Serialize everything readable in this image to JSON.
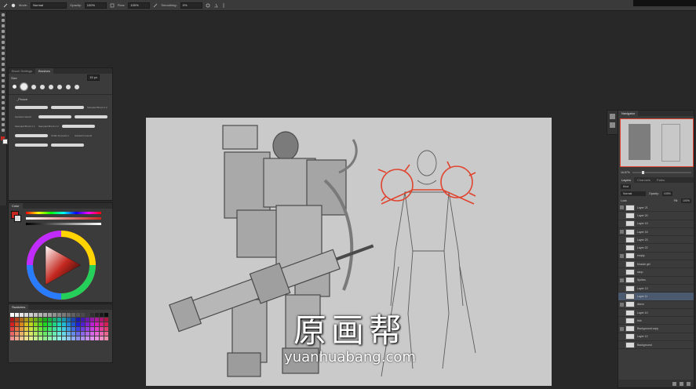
{
  "options_bar": {
    "mode_label": "Mode:",
    "mode_value": "Normal",
    "opacity_label": "Opacity:",
    "opacity_value": "100%",
    "flow_label": "Flow:",
    "flow_value": "100%",
    "smoothing_label": "Smoothing:",
    "smoothing_value": "0%"
  },
  "brush_panel": {
    "tabs": [
      "Brush Settings",
      "Brushes"
    ],
    "size_label": "Size",
    "size_value": "15 px",
    "group_label": "_Procre",
    "brushes": [
      "Sampled Brush 4 2",
      "Sampled Brush 1 1",
      "Chalk 10 pixels 1",
      "standard sketch",
      "Sampled Brush 1 3",
      "standard smooth"
    ]
  },
  "color_panel": {
    "title": "Color",
    "fg_color": "#c4281f"
  },
  "swatches_panel": {
    "title": "Swatches"
  },
  "navigator_panel": {
    "title": "Navigator",
    "zoom": "16.67%"
  },
  "layers_panel": {
    "tabs": [
      "Layers",
      "Channels",
      "Paths"
    ],
    "kind_label": "Kind",
    "blend_mode": "Normal",
    "opacity_label": "Opacity:",
    "opacity_value": "100%",
    "lock_label": "Lock:",
    "fill_label": "Fill:",
    "fill_value": "100%",
    "layers": [
      {
        "name": "Layer 21"
      },
      {
        "name": "Layer 20"
      },
      {
        "name": "Layer 19"
      },
      {
        "name": "Layer 16"
      },
      {
        "name": "Layer 23"
      },
      {
        "name": "Layer 22"
      },
      {
        "name": "empty"
      },
      {
        "name": "Muscle gel"
      },
      {
        "name": "skop"
      },
      {
        "name": "Sprites"
      },
      {
        "name": "Layer 13"
      },
      {
        "name": "Layer 11"
      },
      {
        "name": "dbem"
      },
      {
        "name": "Layer 10"
      },
      {
        "name": "bkb"
      },
      {
        "name": "Background copy"
      },
      {
        "name": "Layer 12"
      },
      {
        "name": "Background"
      }
    ]
  },
  "watermark": {
    "cn": "原画帮",
    "url": "yuanhuabang.com"
  },
  "colors": {
    "app_bg": "#282828",
    "panel_bg": "#3b3b3b",
    "canvas_bg": "#cacaca",
    "sketch_red": "#e0442f"
  }
}
